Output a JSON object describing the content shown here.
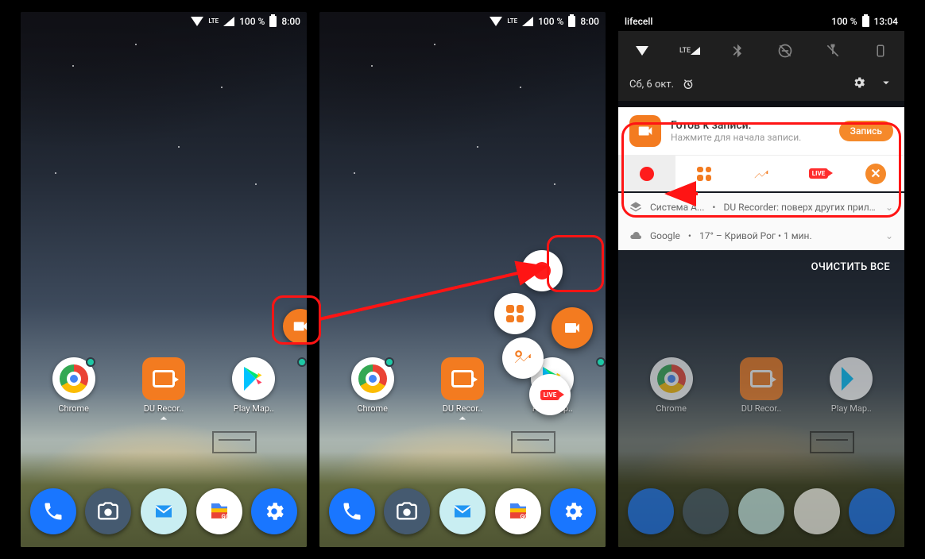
{
  "statusbar": {
    "carrier": "lifecell",
    "battery": "100 %",
    "time1": "8:00",
    "time3": "13:04",
    "network_label": "LTE"
  },
  "home": {
    "apps": {
      "chrome": "Chrome",
      "du": "DU Recor..",
      "play": "Play Мар.."
    }
  },
  "qs": {
    "date": "Сб, 6 окт."
  },
  "notif": {
    "du": {
      "title": "Готов к записи.",
      "subtitle": "Нажмите для начала записи.",
      "action": "Запись"
    },
    "system": {
      "prefix": "Система А...",
      "text": "DU Recorder: поверх других прило..."
    },
    "weather": {
      "provider": "Google",
      "text": "17° – Кривой Рог • 1 мин."
    },
    "clear_all": "ОЧИСТИТЬ ВСЕ"
  },
  "icons": {
    "wifi": "wifi-icon",
    "signal": "signal-icon",
    "battery": "battery-icon",
    "bluetooth": "bluetooth-icon",
    "dnd": "dnd-icon",
    "flashlight": "flashlight-icon",
    "portrait": "portrait-icon",
    "alarm": "alarm-icon",
    "gear": "gear-icon",
    "expand": "chevron-down-icon",
    "record": "record-icon",
    "apps": "apps-grid-icon",
    "tools": "tools-icon",
    "live": "live-icon",
    "close": "close-icon",
    "camera": "video-camera-icon",
    "layers": "layers-icon",
    "cloud": "cloud-icon"
  }
}
